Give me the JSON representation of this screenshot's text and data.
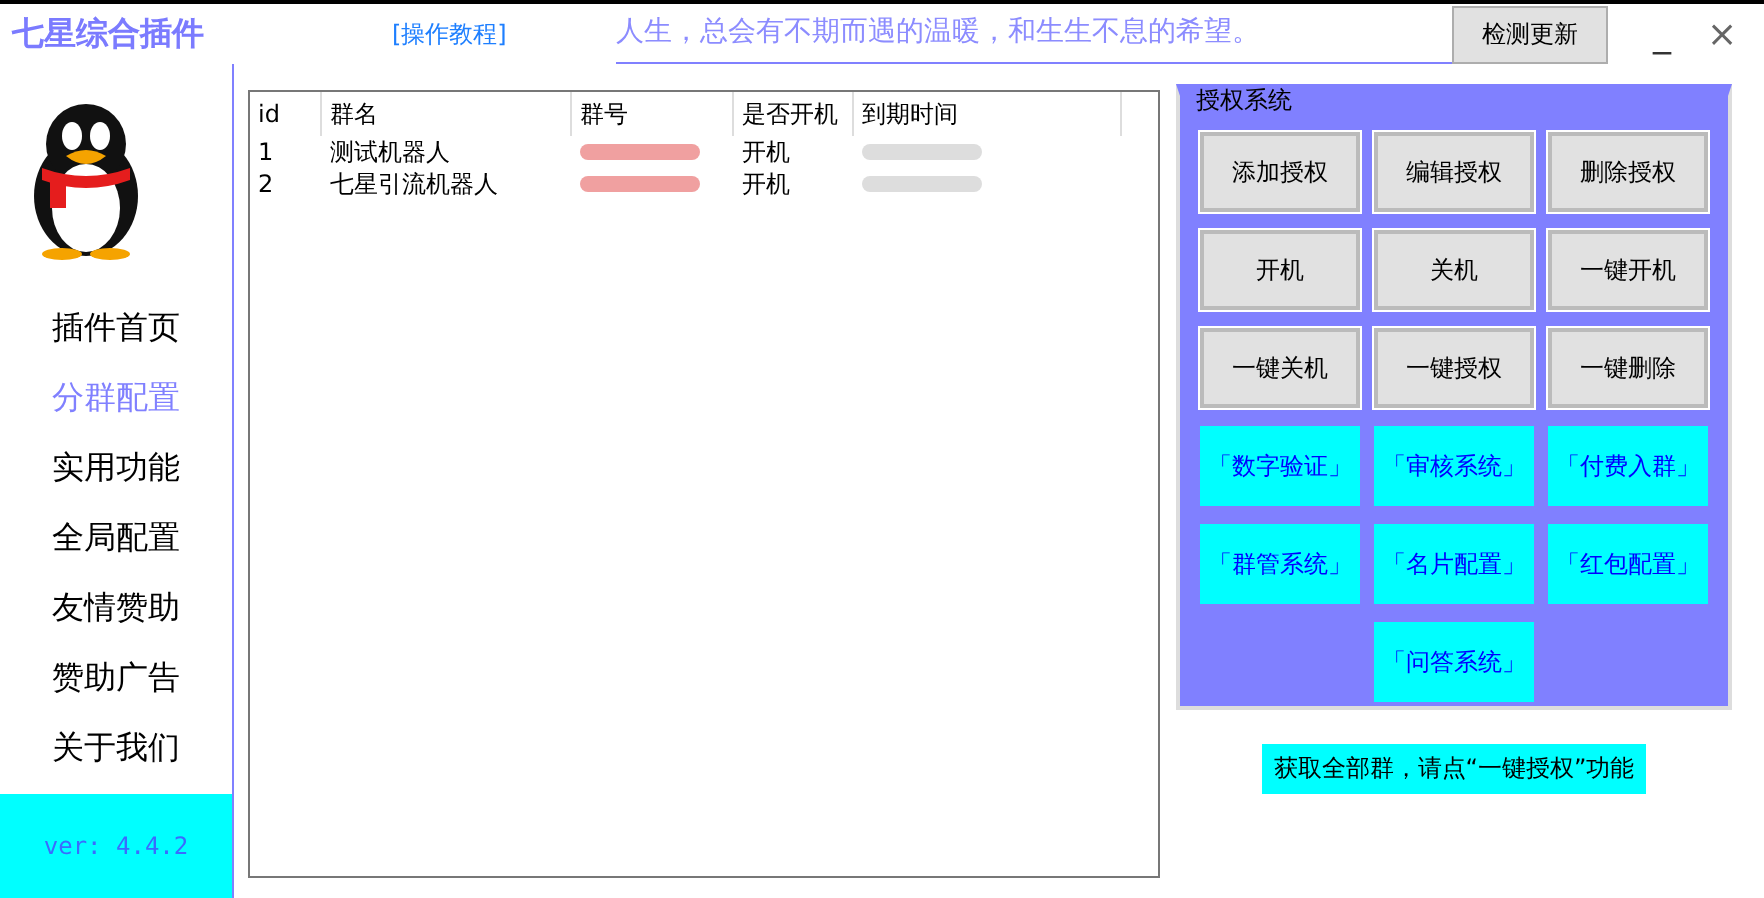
{
  "window": {
    "title": "七星综合插件",
    "tutorial_link": "[操作教程]",
    "slogan": "人生，总会有不期而遇的温暖，和生生不息的希望。",
    "update_button": "检测更新",
    "minimize": "_",
    "close": "×"
  },
  "sidebar": {
    "items": [
      {
        "label": "插件首页",
        "selected": false
      },
      {
        "label": "分群配置",
        "selected": true
      },
      {
        "label": "实用功能",
        "selected": false
      },
      {
        "label": "全局配置",
        "selected": false
      },
      {
        "label": "友情赞助",
        "selected": false
      },
      {
        "label": "赞助广告",
        "selected": false
      },
      {
        "label": "关于我们",
        "selected": false
      }
    ],
    "version": "ver: 4.4.2"
  },
  "table": {
    "columns": [
      "id",
      "群名",
      "群号",
      "是否开机",
      "到期时间"
    ],
    "rows": [
      {
        "id": "1",
        "name": "测试机器人",
        "status": "开机"
      },
      {
        "id": "2",
        "name": "七星引流机器人",
        "status": "开机"
      }
    ]
  },
  "auth_panel": {
    "title": "授权系统",
    "buttons": [
      {
        "label": "添加授权",
        "kind": "gray"
      },
      {
        "label": "编辑授权",
        "kind": "gray"
      },
      {
        "label": "删除授权",
        "kind": "gray"
      },
      {
        "label": "开机",
        "kind": "gray"
      },
      {
        "label": "关机",
        "kind": "gray"
      },
      {
        "label": "一键开机",
        "kind": "gray"
      },
      {
        "label": "一键关机",
        "kind": "gray"
      },
      {
        "label": "一键授权",
        "kind": "gray"
      },
      {
        "label": "一键删除",
        "kind": "gray"
      },
      {
        "label": "「数字验证」",
        "kind": "feature"
      },
      {
        "label": "「审核系统」",
        "kind": "feature"
      },
      {
        "label": "「付费入群」",
        "kind": "feature"
      },
      {
        "label": "「群管系统」",
        "kind": "feature"
      },
      {
        "label": "「名片配置」",
        "kind": "feature"
      },
      {
        "label": "「红包配置」",
        "kind": "feature"
      },
      {
        "label": "「问答系统」",
        "kind": "feature"
      }
    ]
  },
  "hint": "获取全部群，请点“一键授权”功能"
}
